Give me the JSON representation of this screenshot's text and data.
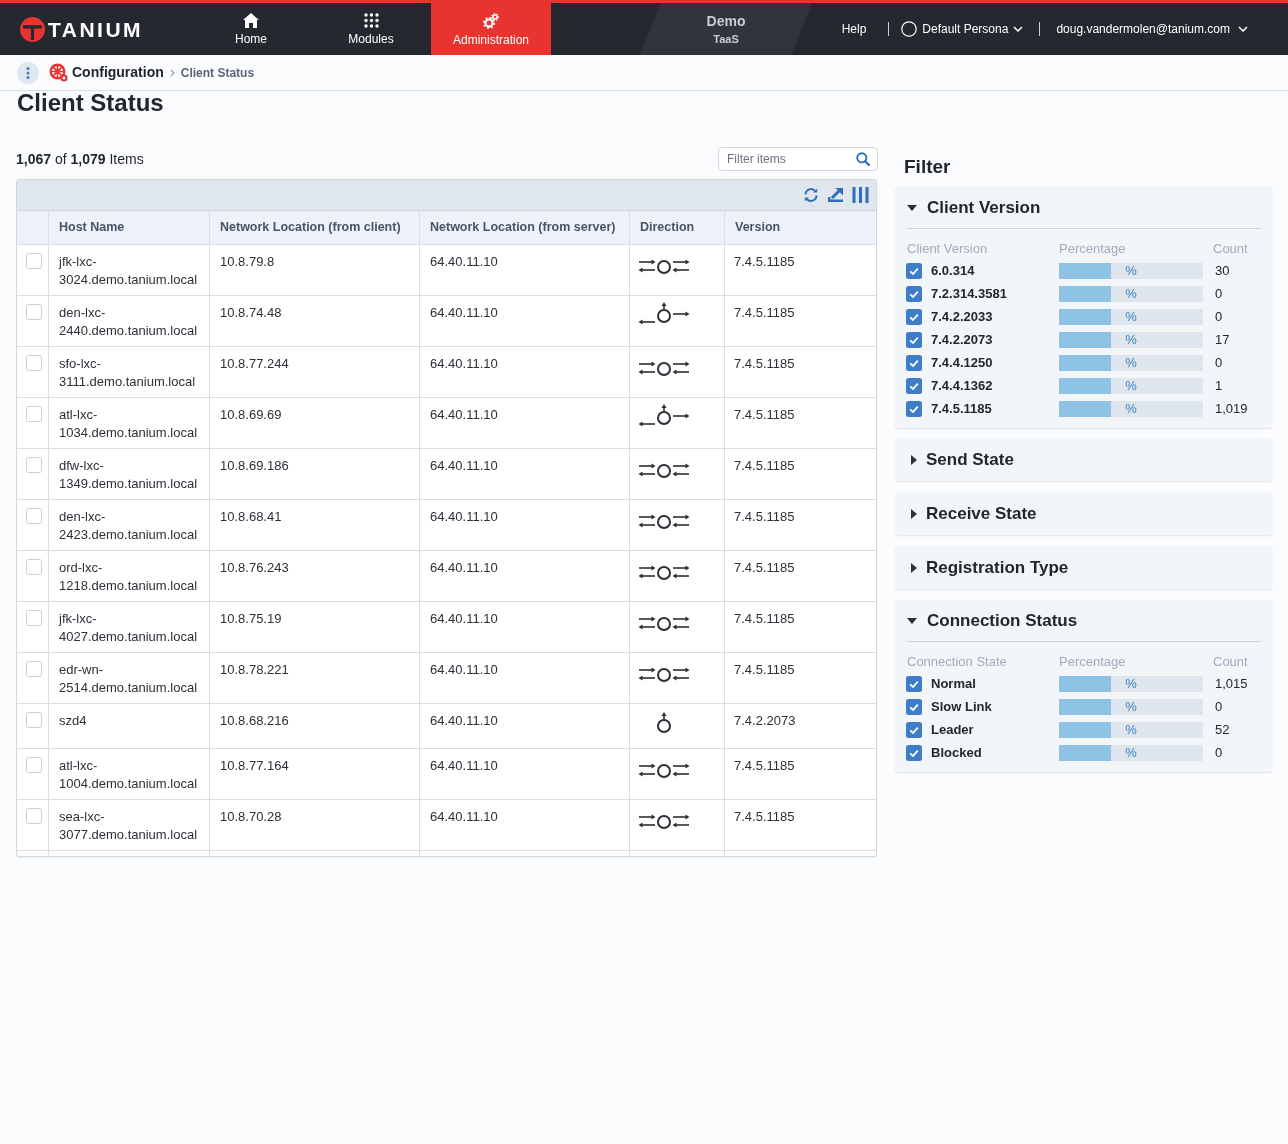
{
  "topbar": {
    "logo": "TANIUM",
    "nav": [
      {
        "label": "Home",
        "selected": false
      },
      {
        "label": "Modules",
        "selected": false
      },
      {
        "label": "Administration",
        "selected": true
      }
    ],
    "environment": {
      "name": "Demo",
      "tier": "TaaS"
    },
    "help": "Help",
    "persona": "Default Persona",
    "user": "doug.vandermolen@tanium.com"
  },
  "breadcrumb": {
    "parent": "Configuration",
    "current": "Client Status"
  },
  "page_title": "Client Status",
  "summary": "**1,067** of **1,079** Items",
  "search": {
    "placeholder": "Filter items"
  },
  "table": {
    "columns": [
      "Host Name",
      "Network Location (from client)",
      "Network Location (from server)",
      "Direction",
      "Version"
    ],
    "rows": [
      {
        "selected": false,
        "host_name": "jfk-lxc-3024.demo.tanium.local",
        "client_location": "10.8.79.8",
        "server_location": "64.40.11.10",
        "direction": {
          "kind": "bidirectional"
        },
        "version": "7.4.5.1185"
      },
      {
        "selected": false,
        "host_name": "den-lxc-2440.demo.tanium.local",
        "client_location": "10.8.74.48",
        "server_location": "64.40.11.10",
        "direction": {
          "kind": "split"
        },
        "version": "7.4.5.1185"
      },
      {
        "selected": false,
        "host_name": "sfo-lxc-3111.demo.tanium.local",
        "client_location": "10.8.77.244",
        "server_location": "64.40.11.10",
        "direction": {
          "kind": "bidirectional"
        },
        "version": "7.4.5.1185"
      },
      {
        "selected": false,
        "host_name": "atl-lxc-1034.demo.tanium.local",
        "client_location": "10.8.69.69",
        "server_location": "64.40.11.10",
        "direction": {
          "kind": "split"
        },
        "version": "7.4.5.1185"
      },
      {
        "selected": false,
        "host_name": "dfw-lxc-1349.demo.tanium.local",
        "client_location": "10.8.69.186",
        "server_location": "64.40.11.10",
        "direction": {
          "kind": "bidirectional"
        },
        "version": "7.4.5.1185"
      },
      {
        "selected": false,
        "host_name": "den-lxc-2423.demo.tanium.local",
        "client_location": "10.8.68.41",
        "server_location": "64.40.11.10",
        "direction": {
          "kind": "bidirectional"
        },
        "version": "7.4.5.1185"
      },
      {
        "selected": false,
        "host_name": "ord-lxc-1218.demo.tanium.local",
        "client_location": "10.8.76.243",
        "server_location": "64.40.11.10",
        "direction": {
          "kind": "bidirectional"
        },
        "version": "7.4.5.1185"
      },
      {
        "selected": false,
        "host_name": "jfk-lxc-4027.demo.tanium.local",
        "client_location": "10.8.75.19",
        "server_location": "64.40.11.10",
        "direction": {
          "kind": "bidirectional"
        },
        "version": "7.4.5.1185"
      },
      {
        "selected": false,
        "host_name": "edr-wn-2514.demo.tanium.local",
        "client_location": "10.8.78.221",
        "server_location": "64.40.11.10",
        "direction": {
          "kind": "bidirectional"
        },
        "version": "7.4.5.1185"
      },
      {
        "selected": false,
        "host_name": "szd4",
        "client_location": "10.8.68.216",
        "server_location": "64.40.11.10",
        "direction": {
          "kind": "up"
        },
        "version": "7.4.2.2073"
      },
      {
        "selected": false,
        "host_name": "atl-lxc-1004.demo.tanium.local",
        "client_location": "10.8.77.164",
        "server_location": "64.40.11.10",
        "direction": {
          "kind": "bidirectional"
        },
        "version": "7.4.5.1185"
      },
      {
        "selected": false,
        "host_name": "sea-lxc-3077.demo.tanium.local",
        "client_location": "10.8.70.28",
        "server_location": "64.40.11.10",
        "direction": {
          "kind": "bidirectional"
        },
        "version": "7.4.5.1185"
      }
    ]
  },
  "filter": {
    "title": "Filter",
    "sections": [
      {
        "title": "Client Version",
        "expanded": true,
        "columns": [
          "Client Version",
          "Percentage",
          "Count"
        ],
        "items": [
          {
            "label": "6.0.314",
            "checked": true,
            "level": 0.36,
            "percent": "%",
            "count": "30"
          },
          {
            "label": "7.2.314.3581",
            "checked": true,
            "level": 0.36,
            "percent": "%",
            "count": "0"
          },
          {
            "label": "7.4.2.2033",
            "checked": true,
            "level": 0.36,
            "percent": "%",
            "count": "0"
          },
          {
            "label": "7.4.2.2073",
            "checked": true,
            "level": 0.36,
            "percent": "%",
            "count": "17"
          },
          {
            "label": "7.4.4.1250",
            "checked": true,
            "level": 0.36,
            "percent": "%",
            "count": "0"
          },
          {
            "label": "7.4.4.1362",
            "checked": true,
            "level": 0.36,
            "percent": "%",
            "count": "1"
          },
          {
            "label": "7.4.5.1185",
            "checked": true,
            "level": 0.36,
            "percent": "%",
            "count": "1,019"
          }
        ]
      },
      {
        "title": "Send State",
        "expanded": false
      },
      {
        "title": "Receive State",
        "expanded": false
      },
      {
        "title": "Registration Type",
        "expanded": false
      },
      {
        "title": "Connection Status",
        "expanded": true,
        "columns": [
          "Connection State",
          "Percentage",
          "Count"
        ],
        "items": [
          {
            "label": "Normal",
            "checked": true,
            "level": 0.36,
            "percent": "%",
            "count": "1,015"
          },
          {
            "label": "Slow Link",
            "checked": true,
            "level": 0.36,
            "percent": "%",
            "count": "0"
          },
          {
            "label": "Leader",
            "checked": true,
            "level": 0.36,
            "percent": "%",
            "count": "52"
          },
          {
            "label": "Blocked",
            "checked": true,
            "level": 0.36,
            "percent": "%",
            "count": "0"
          }
        ]
      }
    ]
  }
}
